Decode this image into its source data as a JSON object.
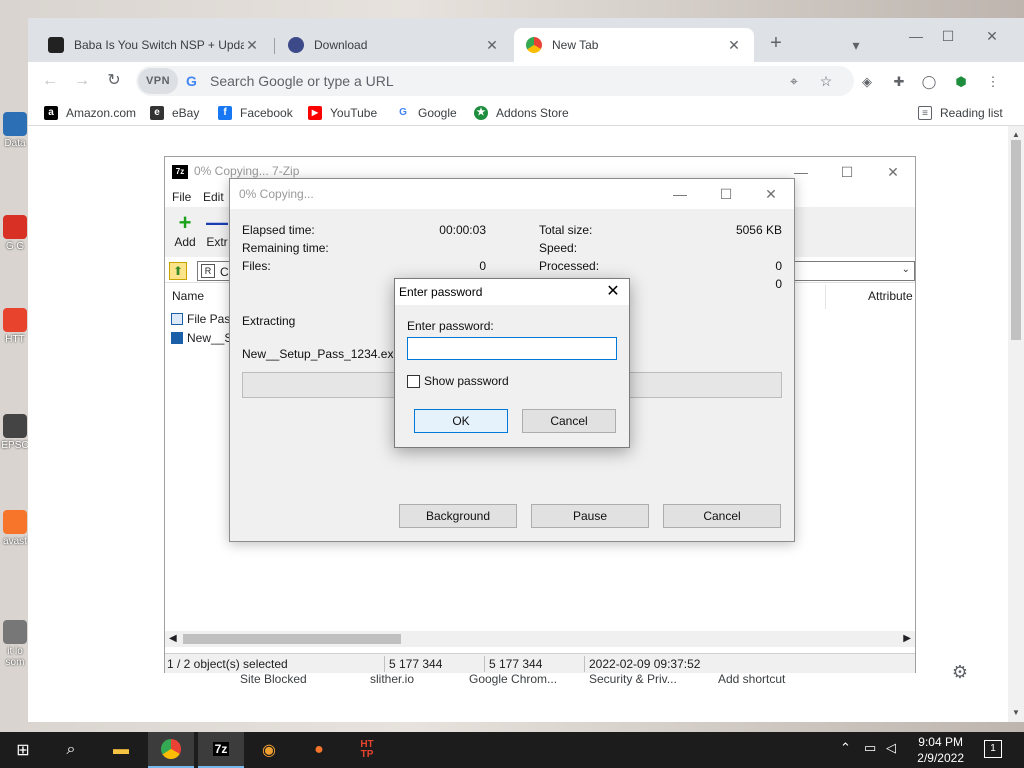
{
  "desktop": {
    "icons": [
      {
        "label": "Data",
        "color": "#2d6fb5"
      },
      {
        "label": "G G",
        "color": "#d93025"
      },
      {
        "label": "HTT",
        "color": "#e8442d"
      },
      {
        "label": "EPSC",
        "color": "#444444"
      },
      {
        "label": "avast",
        "color": "#f7752b"
      },
      {
        "label": "it lo som",
        "color": "#777777"
      }
    ]
  },
  "chrome": {
    "tabs": [
      {
        "title": "Baba Is You Switch NSP + Updat",
        "icon": "switch-icon",
        "close": "✕"
      },
      {
        "title": "Download",
        "icon": "globe-icon",
        "close": "✕"
      },
      {
        "title": "New Tab",
        "icon": "chrome-icon",
        "close": "✕"
      }
    ],
    "new_tab": "+",
    "omnibox": {
      "vpn": "VPN",
      "placeholder": "Search Google or type a URL"
    },
    "bookmarks": [
      {
        "label": "Amazon.com",
        "icon": "amazon-icon",
        "color": "#000000",
        "glyph": "a"
      },
      {
        "label": "eBay",
        "icon": "ebay-icon",
        "color": "#333333",
        "glyph": "e"
      },
      {
        "label": "Facebook",
        "icon": "facebook-icon",
        "color": "#1877f2",
        "glyph": "f"
      },
      {
        "label": "YouTube",
        "icon": "youtube-icon",
        "color": "#ff0000",
        "glyph": "▶"
      },
      {
        "label": "Google",
        "icon": "google-icon",
        "color": "#4285f4",
        "glyph": "G"
      },
      {
        "label": "Addons Store",
        "icon": "addons-icon",
        "color": "#1e8e3e",
        "glyph": "★"
      }
    ],
    "reading_list": "Reading list",
    "shortcuts": [
      "Site Blocked",
      "slither.io",
      "Google Chrom...",
      "Security & Priv...",
      "Add shortcut"
    ]
  },
  "sevenzip": {
    "title": "0% Copying... 7-Zip",
    "logo": "7z",
    "menu": [
      "File",
      "Edit"
    ],
    "tools": [
      {
        "label": "Add",
        "glyph": "+",
        "color": "#1aa31a"
      },
      {
        "label": "Extr",
        "glyph": "—",
        "color": "#1a3fb5"
      }
    ],
    "address": "C",
    "columns": [
      "Name",
      "Attribute"
    ],
    "rows": [
      "File Pass",
      "New__S"
    ],
    "status": {
      "selected": "1 / 2 object(s) selected",
      "size": "5 177 344",
      "packed": "5 177 344",
      "modified": "2022-02-09 09:37:52"
    }
  },
  "copying": {
    "title": "0% Copying...",
    "elapsed_label": "Elapsed time:",
    "elapsed_value": "00:00:03",
    "remaining_label": "Remaining time:",
    "files_label": "Files:",
    "files_value": "0",
    "total_label": "Total size:",
    "total_value": "5056 KB",
    "speed_label": "Speed:",
    "processed_label": "Processed:",
    "processed_value": "0",
    "extra_value": "0",
    "action": "Extracting",
    "filename": "New__Setup_Pass_1234.exe",
    "progress": 0,
    "buttons": {
      "background": "Background",
      "pause": "Pause",
      "cancel": "Cancel"
    }
  },
  "password_dialog": {
    "title": "Enter password",
    "label": "Enter password:",
    "value": "",
    "show_password": "Show password",
    "show_checked": false,
    "ok": "OK",
    "cancel": "Cancel"
  },
  "taskbar": {
    "apps": [
      "start-icon",
      "search-icon",
      "file-explorer-icon",
      "chrome-icon",
      "7zip-icon",
      "brave-icon",
      "avast-icon",
      "http-icon"
    ],
    "time": "9:04 PM",
    "date": "2/9/2022",
    "notifications": "1"
  }
}
